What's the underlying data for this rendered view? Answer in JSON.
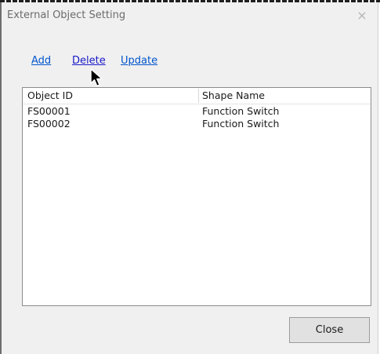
{
  "window": {
    "title": "External Object Setting",
    "close_glyph": "×"
  },
  "actions": {
    "add_label": "Add",
    "delete_label": "Delete",
    "update_label": "Update"
  },
  "table": {
    "columns": [
      "Object ID",
      "Shape Name"
    ],
    "rows": [
      [
        "FS00001",
        "Function Switch"
      ],
      [
        "FS00002",
        "Function Switch"
      ]
    ]
  },
  "footer": {
    "close_label": "Close"
  },
  "icons": {
    "cursor": "mouse-pointer-icon",
    "close": "close-icon"
  }
}
